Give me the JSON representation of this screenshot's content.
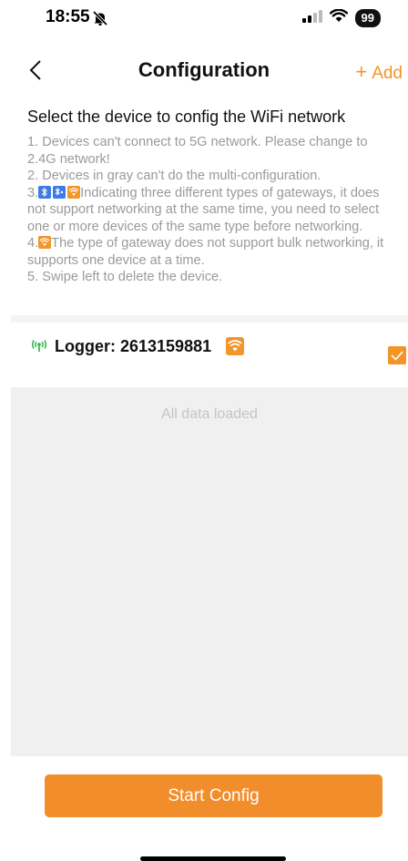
{
  "status_bar": {
    "time": "18:55",
    "battery": "99"
  },
  "nav": {
    "title": "Configuration",
    "add_plus": "+",
    "add_label": "Add"
  },
  "section_title": "Select the device to config the WiFi network",
  "instructions": {
    "line1": "1. Devices can't connect to 5G network. Please change to 2.4G network!",
    "line2": "2. Devices in gray can't do the multi-configuration.",
    "line3_prefix": "3.",
    "line3_text": "Indicating three different types of gateways, it does not support networking at the same time, you need to select one or more devices of the same type before networking.",
    "line4_prefix": "4.",
    "line4_text": "The type of gateway does not support bulk networking, it supports one device at a time.",
    "line5": "5. Swipe left to delete the device."
  },
  "device": {
    "label": "Logger: 2613159881",
    "checked": true
  },
  "list_footer": "All data loaded",
  "start_button": "Start Config",
  "colors": {
    "accent": "#f39529",
    "signal_green": "#2fb344",
    "badge_blue": "#3d7be6",
    "list_bg": "#f0f0f0"
  }
}
